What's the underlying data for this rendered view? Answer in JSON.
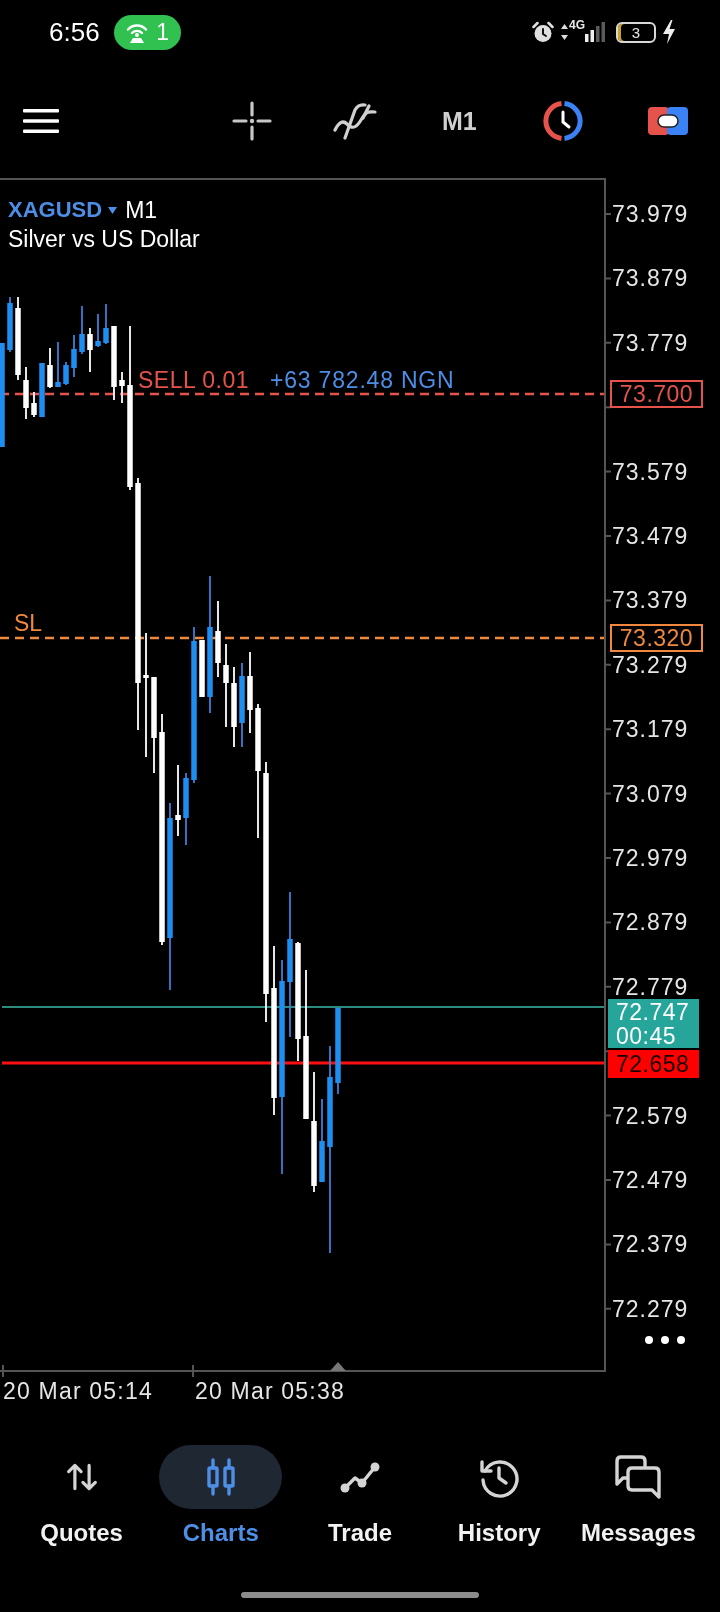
{
  "status_bar": {
    "time": "6:56",
    "hotspot_count": "1",
    "network": "4G",
    "battery": "3"
  },
  "toolbar": {
    "timeframe": "M1"
  },
  "chart": {
    "symbol": "XAGUSD",
    "timeframe": "M1",
    "description": "Silver vs US Dollar",
    "position": {
      "label": "SELL 0.01",
      "profit": "+63 782.48 NGN",
      "price": "73.700"
    },
    "stop_loss": {
      "label": "SL",
      "price": "73.320"
    },
    "bid": {
      "price": "72.747",
      "countdown": "00:45"
    },
    "ask": {
      "price": "72.658"
    },
    "price_axis": [
      "73.979",
      "73.879",
      "73.779",
      "73.579",
      "73.479",
      "73.379",
      "73.279",
      "73.179",
      "73.079",
      "72.979",
      "72.879",
      "72.779",
      "72.579",
      "72.479",
      "72.379",
      "72.279"
    ],
    "time_axis": [
      "20 Mar 05:14",
      "20 Mar 05:38"
    ]
  },
  "nav": [
    {
      "label": "Quotes",
      "selected": false
    },
    {
      "label": "Charts",
      "selected": true
    },
    {
      "label": "Trade",
      "selected": false
    },
    {
      "label": "History",
      "selected": false
    },
    {
      "label": "Messages",
      "selected": false
    }
  ]
}
